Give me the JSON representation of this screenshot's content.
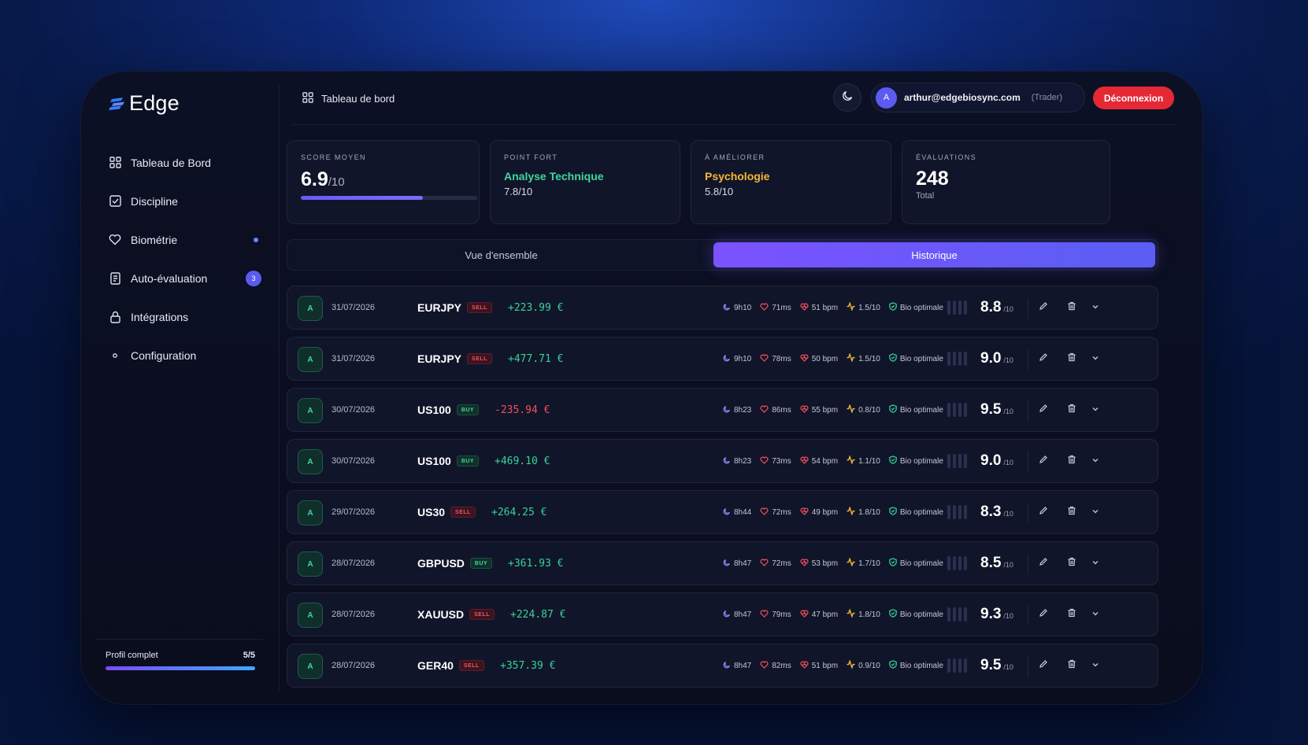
{
  "app": {
    "logo": "Edge",
    "page_title": "Tableau de bord"
  },
  "sidebar": {
    "items": [
      {
        "label": "Tableau de Bord",
        "icon": "grid-icon"
      },
      {
        "label": "Discipline",
        "icon": "checkbox-icon"
      },
      {
        "label": "Biométrie",
        "icon": "heart-icon",
        "dot": true
      },
      {
        "label": "Auto-évaluation",
        "icon": "clipboard-icon",
        "badge": "3"
      },
      {
        "label": "Intégrations",
        "icon": "lock-icon"
      },
      {
        "label": "Configuration",
        "icon": "dot-icon"
      }
    ],
    "profile": {
      "label": "Profil complet",
      "value": "5/5",
      "progress": 1.0
    }
  },
  "header": {
    "user_initial": "A",
    "email": "arthur@edgebiosync.com",
    "role": "(Trader)",
    "logout": "Déconnexion"
  },
  "stats": {
    "score": {
      "label": "SCORE MOYEN",
      "value": "6.9",
      "suffix": "/10",
      "progress": 0.69
    },
    "strong": {
      "label": "POINT FORT",
      "title": "Analyse Technique",
      "value": "7.8/10"
    },
    "improve": {
      "label": "À AMÉLIORER",
      "title": "Psychologie",
      "value": "5.8/10"
    },
    "evals": {
      "label": "ÉVALUATIONS",
      "value": "248",
      "sub": "Total"
    }
  },
  "tabs": [
    {
      "label": "Vue d'ensemble",
      "active": false
    },
    {
      "label": "Historique",
      "active": true
    }
  ],
  "colors": {
    "accent": "#6a5cf5",
    "positive": "#35d49a",
    "negative": "#f0505c",
    "strong": "#3fd69e",
    "improve": "#f5b935",
    "logout": "#e42935"
  },
  "trades": [
    {
      "grade": "A",
      "date": "31/07/2026",
      "pair": "EURJPY",
      "side": "SELL",
      "pnl": "+223.99 €",
      "sleep": "9h10",
      "reaction": "71ms",
      "bpm": "51 bpm",
      "stress": "1.5/10",
      "bio": "Bio optimale",
      "score": "8.8",
      "of": "/10"
    },
    {
      "grade": "A",
      "date": "31/07/2026",
      "pair": "EURJPY",
      "side": "SELL",
      "pnl": "+477.71 €",
      "sleep": "9h10",
      "reaction": "78ms",
      "bpm": "50 bpm",
      "stress": "1.5/10",
      "bio": "Bio optimale",
      "score": "9.0",
      "of": "/10"
    },
    {
      "grade": "A",
      "date": "30/07/2026",
      "pair": "US100",
      "side": "BUY",
      "pnl": "-235.94 €",
      "sleep": "8h23",
      "reaction": "86ms",
      "bpm": "55 bpm",
      "stress": "0.8/10",
      "bio": "Bio optimale",
      "score": "9.5",
      "of": "/10"
    },
    {
      "grade": "A",
      "date": "30/07/2026",
      "pair": "US100",
      "side": "BUY",
      "pnl": "+469.10 €",
      "sleep": "8h23",
      "reaction": "73ms",
      "bpm": "54 bpm",
      "stress": "1.1/10",
      "bio": "Bio optimale",
      "score": "9.0",
      "of": "/10"
    },
    {
      "grade": "A",
      "date": "29/07/2026",
      "pair": "US30",
      "side": "SELL",
      "pnl": "+264.25 €",
      "sleep": "8h44",
      "reaction": "72ms",
      "bpm": "49 bpm",
      "stress": "1.8/10",
      "bio": "Bio optimale",
      "score": "8.3",
      "of": "/10"
    },
    {
      "grade": "A",
      "date": "28/07/2026",
      "pair": "GBPUSD",
      "side": "BUY",
      "pnl": "+361.93 €",
      "sleep": "8h47",
      "reaction": "72ms",
      "bpm": "53 bpm",
      "stress": "1.7/10",
      "bio": "Bio optimale",
      "score": "8.5",
      "of": "/10"
    },
    {
      "grade": "A",
      "date": "28/07/2026",
      "pair": "XAUUSD",
      "side": "SELL",
      "pnl": "+224.87 €",
      "sleep": "8h47",
      "reaction": "79ms",
      "bpm": "47 bpm",
      "stress": "1.8/10",
      "bio": "Bio optimale",
      "score": "9.3",
      "of": "/10"
    },
    {
      "grade": "A",
      "date": "28/07/2026",
      "pair": "GER40",
      "side": "SELL",
      "pnl": "+357.39 €",
      "sleep": "8h47",
      "reaction": "82ms",
      "bpm": "51 bpm",
      "stress": "0.9/10",
      "bio": "Bio optimale",
      "score": "9.5",
      "of": "/10"
    }
  ]
}
